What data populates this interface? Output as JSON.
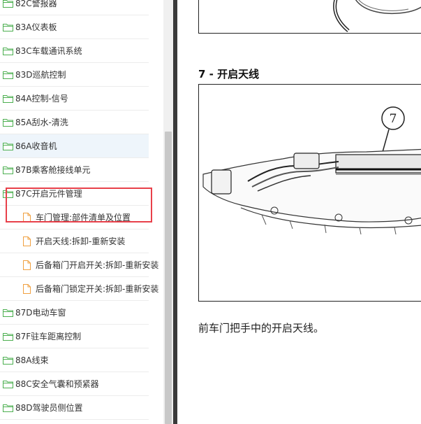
{
  "sidebar": {
    "items": [
      {
        "label": "82C警报器",
        "type": "folder"
      },
      {
        "label": "83A仪表板",
        "type": "folder"
      },
      {
        "label": "83C车载通讯系统",
        "type": "folder"
      },
      {
        "label": "83D巡航控制",
        "type": "folder"
      },
      {
        "label": "84A控制-信号",
        "type": "folder"
      },
      {
        "label": "85A刮水-清洗",
        "type": "folder"
      },
      {
        "label": "86A收音机",
        "type": "folder",
        "selected": true
      },
      {
        "label": "87B乘客舱接线单元",
        "type": "folder"
      },
      {
        "label": "87C开启元件管理",
        "type": "folder",
        "expanded": true
      },
      {
        "label": "车门管理:部件清单及位置",
        "type": "document"
      },
      {
        "label": "开启天线:拆卸-重新安装",
        "type": "document"
      },
      {
        "label": "后备箱门开启开关:拆卸-重新安装",
        "type": "document"
      },
      {
        "label": "后备箱门锁定开关:拆卸-重新安装",
        "type": "document"
      },
      {
        "label": "87D电动车窗",
        "type": "folder"
      },
      {
        "label": "87F驻车距离控制",
        "type": "folder"
      },
      {
        "label": "88A线束",
        "type": "folder"
      },
      {
        "label": "88C安全气囊和预紧器",
        "type": "folder"
      },
      {
        "label": "88D驾驶员侧位置",
        "type": "folder"
      }
    ]
  },
  "content": {
    "heading": "7 - 开启天线",
    "callout": "7",
    "caption": "前车门把手中的开启天线。"
  },
  "colors": {
    "folder": "#4caf50",
    "document": "#f0a040",
    "highlight": "#e8404a",
    "selected_row": "#eef5fb"
  }
}
